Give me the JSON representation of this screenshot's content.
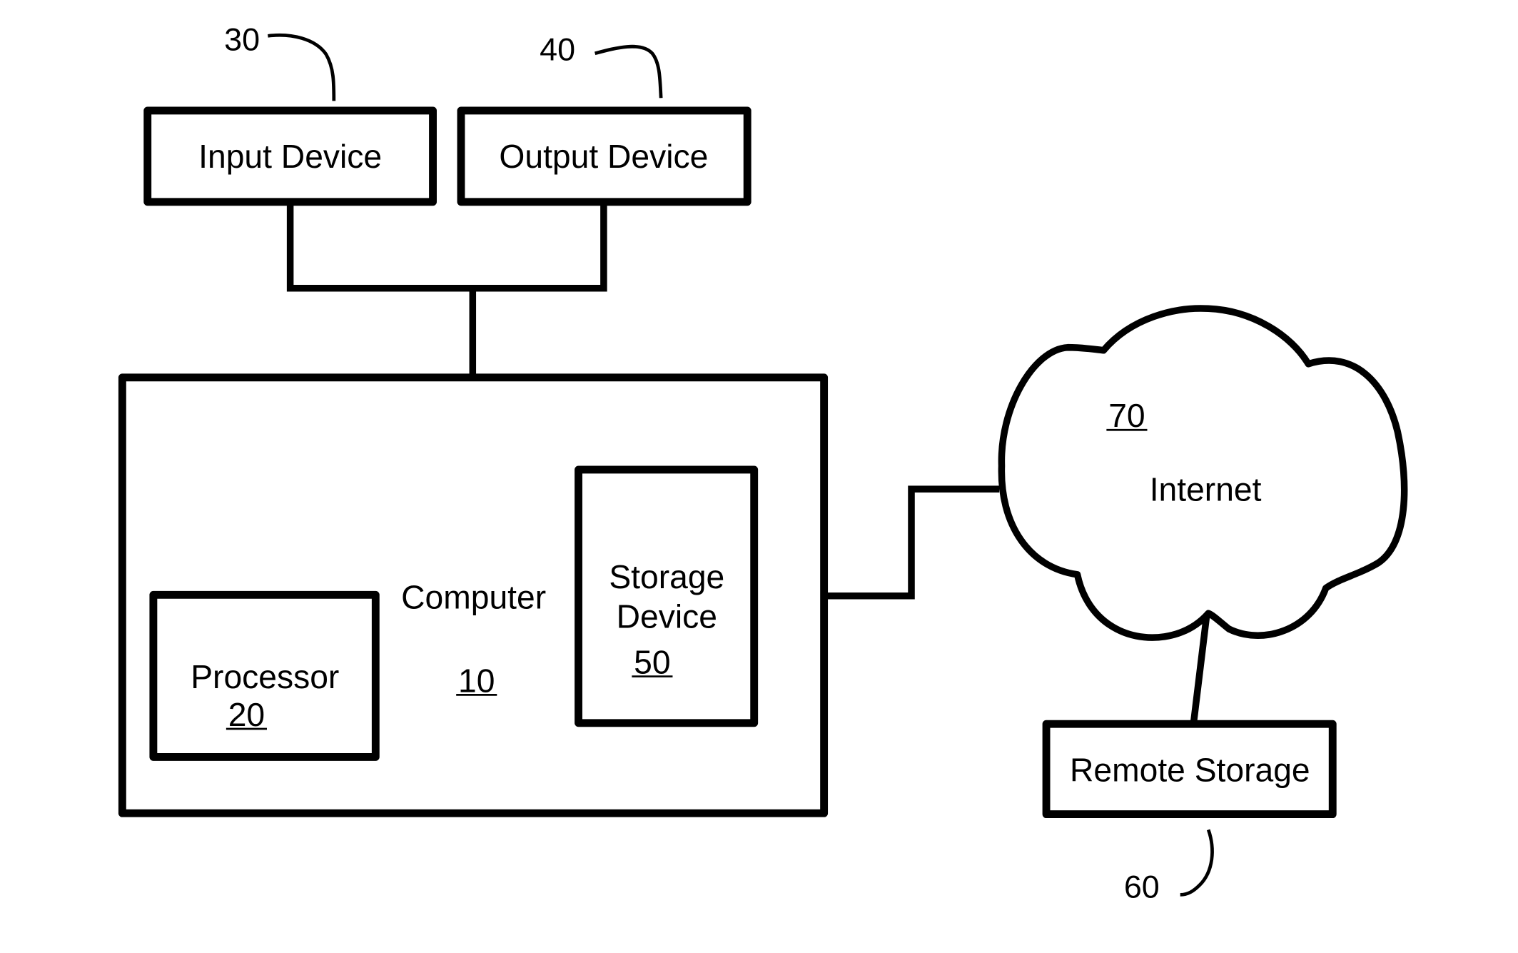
{
  "figure": {
    "type": "block-diagram",
    "colors": {
      "line": "#000000",
      "background": "#ffffff"
    }
  },
  "nodes": {
    "input_device": {
      "label": "Input Device",
      "ref": "30"
    },
    "output_device": {
      "label": "Output Device",
      "ref": "40"
    },
    "computer": {
      "label": "Computer",
      "ref": "10"
    },
    "processor": {
      "label": "Processor",
      "ref": "20"
    },
    "storage_device": {
      "label_line1": "Storage",
      "label_line2": "Device",
      "ref": "50"
    },
    "internet": {
      "label": "Internet",
      "ref": "70"
    },
    "remote_storage": {
      "label": "Remote Storage",
      "ref": "60"
    }
  },
  "connections": [
    {
      "from": "input_device",
      "to": "computer"
    },
    {
      "from": "output_device",
      "to": "computer"
    },
    {
      "from": "computer",
      "to": "internet"
    },
    {
      "from": "internet",
      "to": "remote_storage"
    }
  ]
}
